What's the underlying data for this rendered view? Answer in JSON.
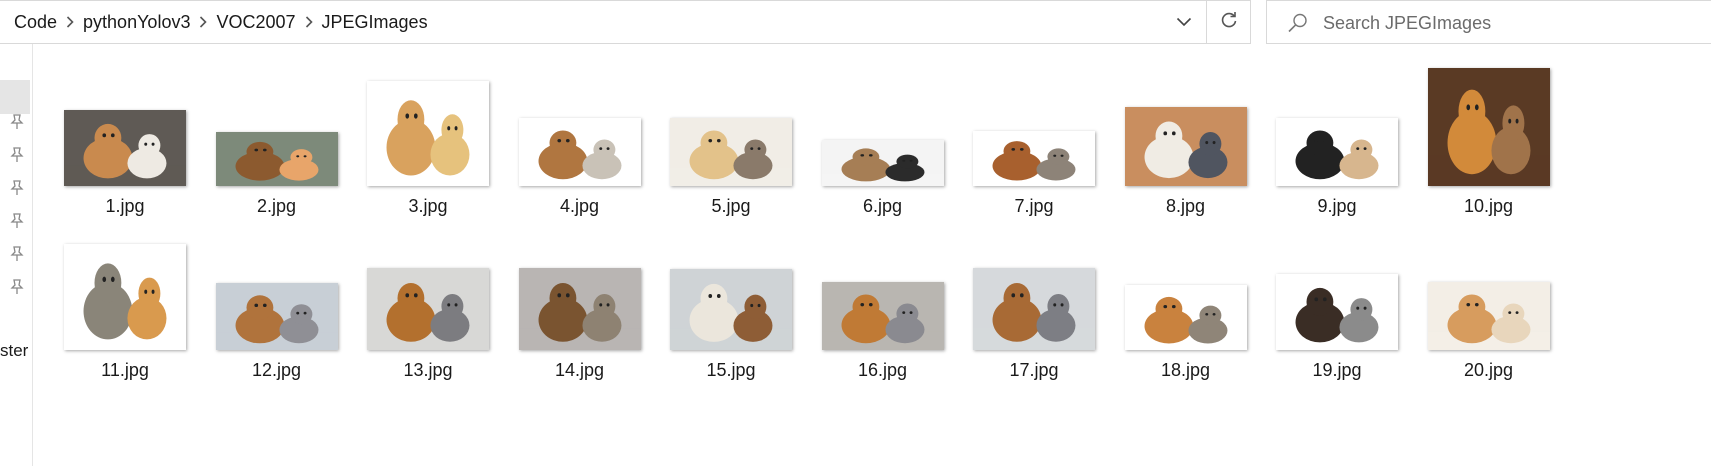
{
  "breadcrumb": {
    "items": [
      "Code",
      "pythonYolov3",
      "VOC2007",
      "JPEGImages"
    ]
  },
  "search": {
    "placeholder": "Search JPEGImages"
  },
  "nav": {
    "partial_label": "ster"
  },
  "icons": {
    "breadcrumb_separator": "chevron-right-icon",
    "address_dropdown": "chevron-down-icon",
    "refresh": "refresh-icon",
    "search": "search-icon",
    "pin": "pin-icon"
  },
  "colors": {
    "border": "#d9d9d9",
    "selected_nav": "#e5e5e5",
    "text": "#1a1a1a",
    "muted_text": "#6b6b6b"
  },
  "files": [
    {
      "name": "1.jpg",
      "bg": "#5f5a55",
      "a": "#c98a4e",
      "b": "#eeeae3"
    },
    {
      "name": "2.jpg",
      "bg": "#7d8a7a",
      "a": "#8c5a2f",
      "b": "#e8a56a"
    },
    {
      "name": "3.jpg",
      "bg": "#ffffff",
      "a": "#d9a25e",
      "b": "#e6c27d"
    },
    {
      "name": "4.jpg",
      "bg": "#ffffff",
      "a": "#b07640",
      "b": "#c9c2b7"
    },
    {
      "name": "5.jpg",
      "bg": "#f1ede6",
      "a": "#e3c28a",
      "b": "#8a7a6a"
    },
    {
      "name": "6.jpg",
      "bg": "#f4f4f4",
      "a": "#a67e55",
      "b": "#2b2b2b"
    },
    {
      "name": "7.jpg",
      "bg": "#ffffff",
      "a": "#a8602e",
      "b": "#8d8378"
    },
    {
      "name": "8.jpg",
      "bg": "#c98e5f",
      "a": "#f0ece4",
      "b": "#505560"
    },
    {
      "name": "9.jpg",
      "bg": "#ffffff",
      "a": "#222222",
      "b": "#d7b68e"
    },
    {
      "name": "10.jpg",
      "bg": "#5a3a24",
      "a": "#d28a3a",
      "b": "#a0734a"
    },
    {
      "name": "11.jpg",
      "bg": "#ffffff",
      "a": "#8a8579",
      "b": "#d99a4e"
    },
    {
      "name": "12.jpg",
      "bg": "#c8cfd6",
      "a": "#b0733c",
      "b": "#8f8f95"
    },
    {
      "name": "13.jpg",
      "bg": "#d8d8d6",
      "a": "#b3702e",
      "b": "#7c7c80"
    },
    {
      "name": "14.jpg",
      "bg": "#b9b5b3",
      "a": "#7a5430",
      "b": "#8e8272"
    },
    {
      "name": "15.jpg",
      "bg": "#cfd3d6",
      "a": "#ebe6dc",
      "b": "#8e5d36"
    },
    {
      "name": "16.jpg",
      "bg": "#b9b6b1",
      "a": "#c07a35",
      "b": "#8a8a90"
    },
    {
      "name": "17.jpg",
      "bg": "#d6d9dc",
      "a": "#a86a35",
      "b": "#7d7e84"
    },
    {
      "name": "18.jpg",
      "bg": "#ffffff",
      "a": "#c9823e",
      "b": "#8f8578"
    },
    {
      "name": "19.jpg",
      "bg": "#ffffff",
      "a": "#3a2d25",
      "b": "#8b8b8b"
    },
    {
      "name": "20.jpg",
      "bg": "#f3eee6",
      "a": "#d79c5e",
      "b": "#e8d6bc"
    }
  ]
}
